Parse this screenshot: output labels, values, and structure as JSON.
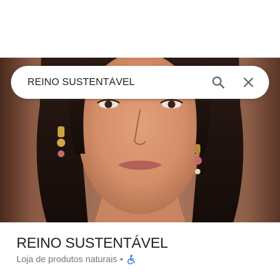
{
  "search": {
    "query": "REINO SUSTENTÁVEL"
  },
  "place": {
    "name": "REINO SUSTENTÁVEL",
    "category": "Loja de produtos naturais",
    "separator": "•"
  },
  "icons": {
    "search": "search-icon",
    "close": "close-icon",
    "accessibility": "wheelchair-accessible-icon"
  },
  "colors": {
    "accent_blue": "#1a73e8",
    "icon_gray": "#5f6368",
    "text_primary": "#202124",
    "text_secondary": "#70757a"
  }
}
